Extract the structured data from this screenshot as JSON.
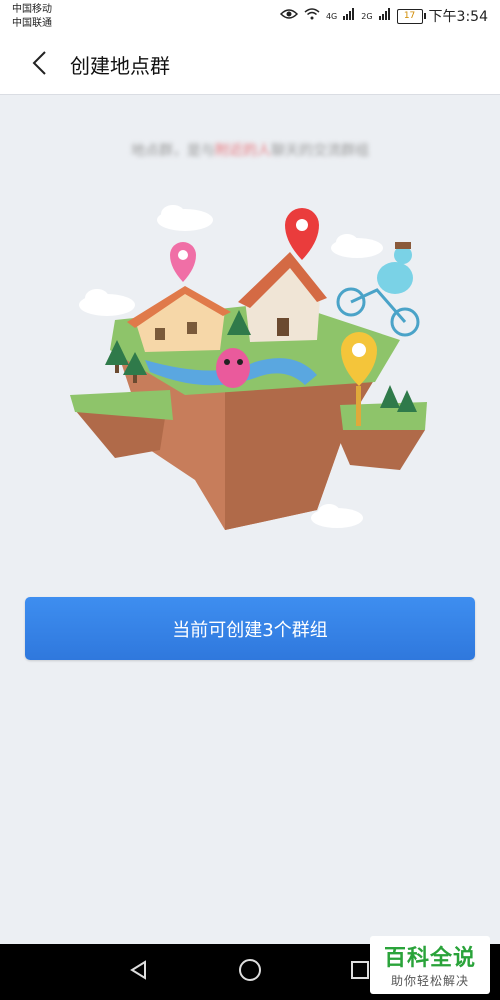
{
  "status": {
    "carrier1": "中国移动",
    "carrier2": "中国联通",
    "net1": "4G",
    "net2": "2G",
    "battery": "17",
    "time": "下午3:54"
  },
  "header": {
    "title": "创建地点群"
  },
  "main": {
    "hint_prefix": "地点群，是与",
    "hint_emph": "附近的人",
    "hint_suffix": "聊天的交流群组",
    "illustration": "floating-island-illustration",
    "create_button": "当前可创建3个群组"
  },
  "watermark": {
    "title": "百科全说",
    "subtitle": "助你轻松解决"
  },
  "colors": {
    "accent": "#3a86ec",
    "background": "#eceff3",
    "watermark_green": "#2aa33a"
  }
}
